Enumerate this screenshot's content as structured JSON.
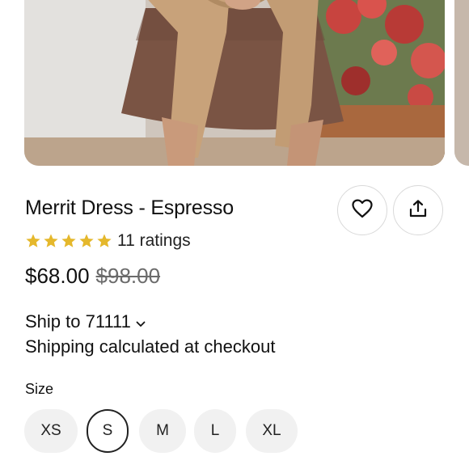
{
  "product": {
    "title": "Merrit Dress - Espresso",
    "rating_stars": 5,
    "ratings_text": "11 ratings",
    "price_current": "$68.00",
    "price_original": "$98.00"
  },
  "shipping": {
    "ship_to_label": "Ship to 71111",
    "note": "Shipping calculated at checkout"
  },
  "size": {
    "label": "Size",
    "options": [
      "XS",
      "S",
      "M",
      "L",
      "XL"
    ],
    "selected": "S"
  },
  "icons": {
    "favorite": "heart-icon",
    "share": "share-icon",
    "dropdown": "chevron-down-icon",
    "star": "star-icon"
  },
  "colors": {
    "star": "#E5B82C",
    "text": "#111111",
    "muted": "#6b6b6b",
    "chip_bg": "#f1f1f1"
  }
}
